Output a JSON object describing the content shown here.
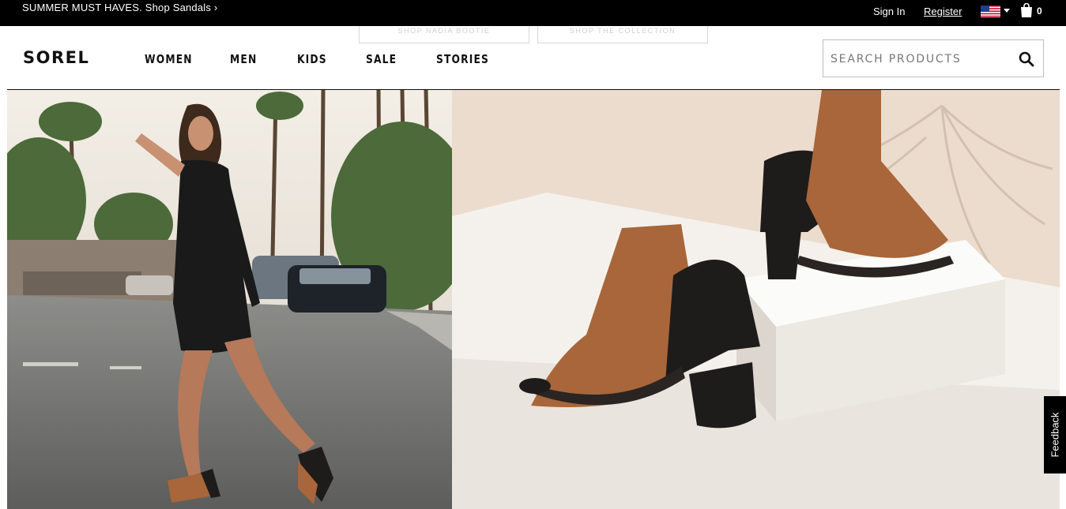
{
  "promo": {
    "text": "SUMMER MUST HAVES. Shop Sandals ›"
  },
  "utility": {
    "signin": "Sign In",
    "register": "Register",
    "bag_count": "0",
    "locale_icon": "us-flag-icon"
  },
  "brand": {
    "logo": "SOREL"
  },
  "nav": {
    "items": [
      {
        "label": "WOMEN"
      },
      {
        "label": "MEN"
      },
      {
        "label": "KIDS"
      },
      {
        "label": "SALE"
      },
      {
        "label": "STORIES"
      }
    ]
  },
  "ghost_buttons": {
    "left": "SHOP NADIA BOOTIE",
    "right": "SHOP THE COLLECTION"
  },
  "search": {
    "placeholder": "SEARCH PRODUCTS",
    "value": ""
  },
  "feedback": {
    "label": "Feedback"
  },
  "colors": {
    "brand": "#000000",
    "bootie_tan": "#a8663a",
    "bootie_black": "#1e1c1b",
    "backdrop_beige": "#ecdccd"
  }
}
